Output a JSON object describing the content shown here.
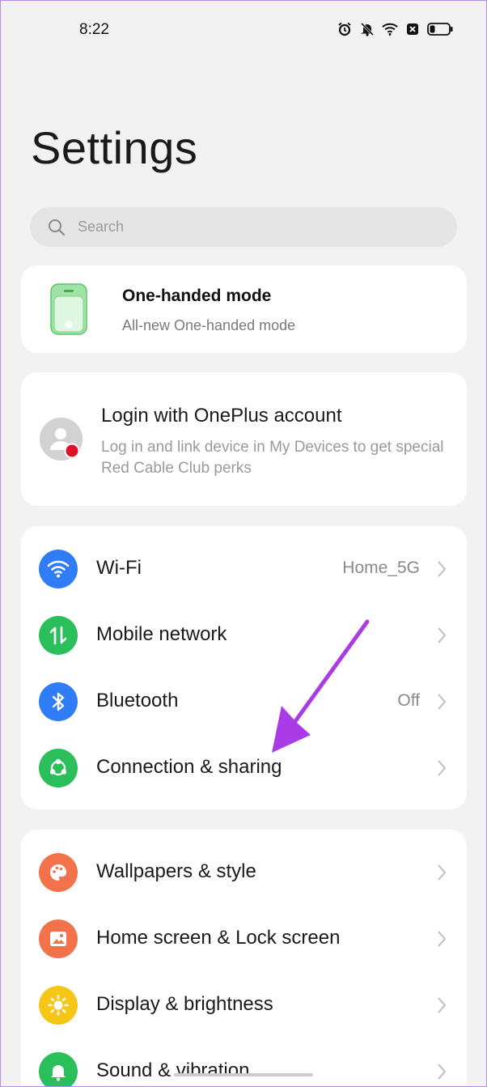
{
  "status_bar": {
    "time": "8:22",
    "icons": [
      "alarm-icon",
      "notifications-muted-icon",
      "wifi-icon",
      "no-sim-icon",
      "battery-icon"
    ]
  },
  "page": {
    "title": "Settings"
  },
  "search": {
    "placeholder": "Search"
  },
  "one_handed": {
    "title": "One-handed mode",
    "subtitle": "All-new One-handed mode"
  },
  "account": {
    "title": "Login with OnePlus account",
    "subtitle": "Log in and link device in My Devices to get special Red Cable Club perks"
  },
  "connectivity": [
    {
      "label": "Wi-Fi",
      "value": "Home_5G",
      "icon": "wifi-icon",
      "color": "#2f7cf6"
    },
    {
      "label": "Mobile network",
      "value": "",
      "icon": "mobile-data-icon",
      "color": "#2bbf5c"
    },
    {
      "label": "Bluetooth",
      "value": "Off",
      "icon": "bluetooth-icon",
      "color": "#2f7cf6"
    },
    {
      "label": "Connection & sharing",
      "value": "",
      "icon": "share-icon",
      "color": "#2bbf5c"
    }
  ],
  "personalization": [
    {
      "label": "Wallpapers & style",
      "icon": "palette-icon",
      "color": "#f2734b"
    },
    {
      "label": "Home screen & Lock screen",
      "icon": "image-icon",
      "color": "#f2734b"
    },
    {
      "label": "Display & brightness",
      "icon": "brightness-icon",
      "color": "#f5c518"
    },
    {
      "label": "Sound & vibration",
      "icon": "bell-icon",
      "color": "#2bbf5c"
    }
  ],
  "colors": {
    "annotation_arrow": "#a93ce6",
    "background": "#f2f2f2"
  }
}
